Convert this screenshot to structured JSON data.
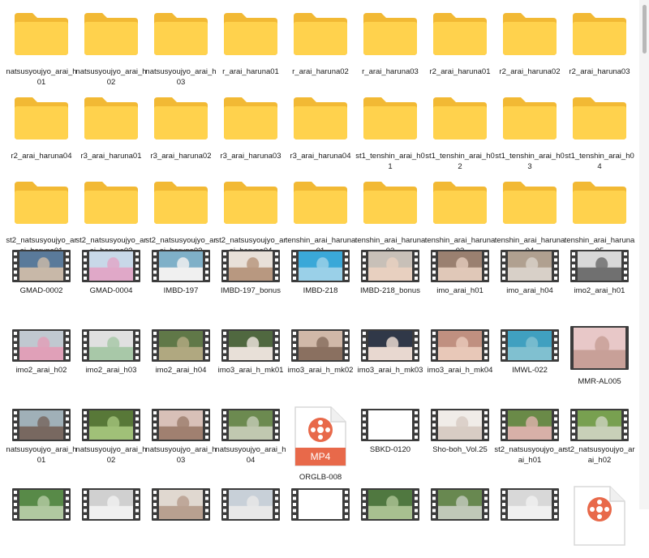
{
  "colors": {
    "folder_back": "#f2b934",
    "folder_front": "#ffd24d",
    "film": "#3c3c3c",
    "mp4_accent": "#e8694a"
  },
  "items": [
    {
      "type": "folder",
      "name": "natsusyoujyo_arai_h01"
    },
    {
      "type": "folder",
      "name": "natsusyoujyo_arai_h02"
    },
    {
      "type": "folder",
      "name": "natsusyoujyo_arai_h03"
    },
    {
      "type": "folder",
      "name": "r_arai_haruna01"
    },
    {
      "type": "folder",
      "name": "r_arai_haruna02"
    },
    {
      "type": "folder",
      "name": "r_arai_haruna03"
    },
    {
      "type": "folder",
      "name": "r2_arai_haruna01"
    },
    {
      "type": "folder",
      "name": "r2_arai_haruna02"
    },
    {
      "type": "folder",
      "name": "r2_arai_haruna03"
    },
    {
      "type": "folder",
      "name": "r2_arai_haruna04"
    },
    {
      "type": "folder",
      "name": "r3_arai_haruna01"
    },
    {
      "type": "folder",
      "name": "r3_arai_haruna02"
    },
    {
      "type": "folder",
      "name": "r3_arai_haruna03"
    },
    {
      "type": "folder",
      "name": "r3_arai_haruna04"
    },
    {
      "type": "folder",
      "name": "st1_tenshin_arai_h01"
    },
    {
      "type": "folder",
      "name": "st1_tenshin_arai_h02"
    },
    {
      "type": "folder",
      "name": "st1_tenshin_arai_h03"
    },
    {
      "type": "folder",
      "name": "st1_tenshin_arai_h04"
    },
    {
      "type": "folder",
      "name": "st2_natsusyoujyo_arai_haruna01"
    },
    {
      "type": "folder",
      "name": "st2_natsusyoujyo_arai_haruna02"
    },
    {
      "type": "folder",
      "name": "st2_natsusyoujyo_arai_haruna03"
    },
    {
      "type": "folder",
      "name": "st2_natsusyoujyo_arai_haruna04"
    },
    {
      "type": "folder",
      "name": "tenshin_arai_haruna01"
    },
    {
      "type": "folder",
      "name": "tenshin_arai_haruna02"
    },
    {
      "type": "folder",
      "name": "tenshin_arai_haruna03"
    },
    {
      "type": "folder",
      "name": "tenshin_arai_haruna04"
    },
    {
      "type": "folder",
      "name": "tenshin_arai_haruna05"
    },
    {
      "type": "video",
      "name": "GMAD-0002",
      "thumb": [
        "#5a7a9a",
        "#c8b8a8"
      ]
    },
    {
      "type": "video",
      "name": "GMAD-0004",
      "thumb": [
        "#c8d8e8",
        "#e0a8c8"
      ]
    },
    {
      "type": "video",
      "name": "IMBD-197",
      "thumb": [
        "#7fb0c8",
        "#f0f0f0"
      ]
    },
    {
      "type": "video",
      "name": "IMBD-197_bonus",
      "thumb": [
        "#e8e0d8",
        "#b89880"
      ]
    },
    {
      "type": "video",
      "name": "IMBD-218",
      "thumb": [
        "#3aa8d8",
        "#9ad0e8"
      ]
    },
    {
      "type": "video",
      "name": "IMBD-218_bonus",
      "thumb": [
        "#c8c0b8",
        "#e8d0c0"
      ]
    },
    {
      "type": "video",
      "name": "imo_arai_h01",
      "thumb": [
        "#9a8070",
        "#e0c8b8"
      ]
    },
    {
      "type": "video",
      "name": "imo_arai_h04",
      "thumb": [
        "#b0a090",
        "#d8d0c8"
      ]
    },
    {
      "type": "video",
      "name": "imo2_arai_h01",
      "thumb": [
        "#d8d8d8",
        "#707070"
      ]
    },
    {
      "type": "video",
      "name": "imo2_arai_h02",
      "thumb": [
        "#c0c8d0",
        "#e0a0b8"
      ]
    },
    {
      "type": "video",
      "name": "imo2_arai_h03",
      "thumb": [
        "#e0e0e0",
        "#a8c8a8"
      ]
    },
    {
      "type": "video",
      "name": "imo2_arai_h04",
      "thumb": [
        "#607848",
        "#b0a880"
      ]
    },
    {
      "type": "video",
      "name": "imo3_arai_h_mk01",
      "thumb": [
        "#506840",
        "#e8e0d8"
      ]
    },
    {
      "type": "video",
      "name": "imo3_arai_h_mk02",
      "thumb": [
        "#d0b8a8",
        "#8a7060"
      ]
    },
    {
      "type": "video",
      "name": "imo3_arai_h_mk03",
      "thumb": [
        "#303848",
        "#e8d8d0"
      ]
    },
    {
      "type": "video",
      "name": "imo3_arai_h_mk04",
      "thumb": [
        "#c09080",
        "#e8c8b8"
      ]
    },
    {
      "type": "video",
      "name": "IMWL-022",
      "thumb": [
        "#40a0c0",
        "#80c0d0"
      ]
    },
    {
      "type": "video",
      "name": "MMR-AL005",
      "thumb": [
        "#e8c8c8",
        "#c8a098"
      ],
      "tall": true
    },
    {
      "type": "video",
      "name": "natsusyoujyo_arai_h01",
      "thumb": [
        "#a0b0b8",
        "#786860"
      ]
    },
    {
      "type": "video",
      "name": "natsusyoujyo_arai_h02",
      "thumb": [
        "#587838",
        "#a0c078"
      ]
    },
    {
      "type": "video",
      "name": "natsusyoujyo_arai_h03",
      "thumb": [
        "#d8c0b8",
        "#a08070"
      ]
    },
    {
      "type": "video",
      "name": "natsusyoujyo_arai_h04",
      "thumb": [
        "#6c8a50",
        "#c0c8b0"
      ]
    },
    {
      "type": "mp4",
      "name": "ORGLB-008",
      "badge": "MP4"
    },
    {
      "type": "video",
      "name": "SBKD-0120",
      "thumb": [
        "#ffffff",
        "#ffffff"
      ]
    },
    {
      "type": "video",
      "name": "Sho-boh_Vol.25",
      "thumb": [
        "#f0ece8",
        "#d8ccc4"
      ]
    },
    {
      "type": "video",
      "name": "st2_natsusyoujyo_arai_h01",
      "thumb": [
        "#6a8a48",
        "#d8b0a8"
      ]
    },
    {
      "type": "video",
      "name": "st2_natsusyoujyo_arai_h02",
      "thumb": [
        "#78a050",
        "#c8d0b8"
      ]
    },
    {
      "type": "video",
      "name": "",
      "thumb": [
        "#588a48",
        "#b0c8a0"
      ]
    },
    {
      "type": "video",
      "name": "",
      "thumb": [
        "#d0d0d0",
        "#f0f0f0"
      ]
    },
    {
      "type": "video",
      "name": "",
      "thumb": [
        "#e0d8d0",
        "#b8a090"
      ]
    },
    {
      "type": "video",
      "name": "",
      "thumb": [
        "#c8d0d8",
        "#e8e8e8"
      ]
    },
    {
      "type": "video",
      "name": "",
      "thumb": [
        "#ffffff",
        "#ffffff"
      ]
    },
    {
      "type": "video",
      "name": "",
      "thumb": [
        "#507840",
        "#a8c090"
      ]
    },
    {
      "type": "video",
      "name": "",
      "thumb": [
        "#688850",
        "#c0c8b8"
      ]
    },
    {
      "type": "video",
      "name": "",
      "thumb": [
        "#d8d8d8",
        "#f0f0f0"
      ]
    },
    {
      "type": "mp4",
      "name": "",
      "badge": ""
    }
  ]
}
